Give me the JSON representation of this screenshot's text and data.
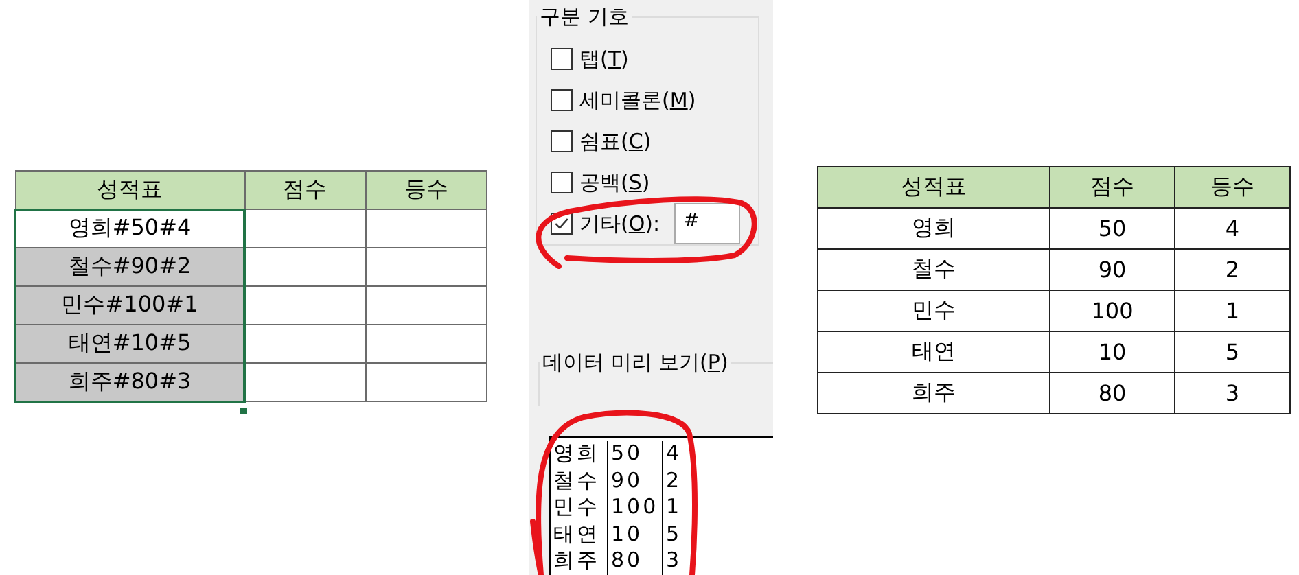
{
  "source_sheet": {
    "columns": [
      "성적표",
      "점수",
      "등수"
    ],
    "rows": [
      {
        "cells": [
          "영희#50#4",
          "",
          ""
        ],
        "active": true
      },
      {
        "cells": [
          "철수#90#2",
          "",
          ""
        ],
        "active": false
      },
      {
        "cells": [
          "민수#100#1",
          "",
          ""
        ],
        "active": false
      },
      {
        "cells": [
          "태연#10#5",
          "",
          ""
        ],
        "active": false
      },
      {
        "cells": [
          "희주#80#3",
          "",
          ""
        ],
        "active": false
      }
    ]
  },
  "delimiters": {
    "title": "구분 기호",
    "options": [
      {
        "label": "탭(",
        "key": "T",
        "tail": ")",
        "checked": false
      },
      {
        "label": "세미콜론(",
        "key": "M",
        "tail": ")",
        "checked": false
      },
      {
        "label": "쉼표(",
        "key": "C",
        "tail": ")",
        "checked": false
      },
      {
        "label": "공백(",
        "key": "S",
        "tail": ")",
        "checked": false
      },
      {
        "label": "기타(",
        "key": "O",
        "tail": "):",
        "checked": true,
        "value": "#"
      }
    ]
  },
  "preview": {
    "title": "데이터 미리 보기(",
    "key": "P",
    "tail": ")",
    "rows": [
      [
        "영희",
        "50",
        "4"
      ],
      [
        "철수",
        "90",
        "2"
      ],
      [
        "민수",
        "100",
        "1"
      ],
      [
        "태연",
        "10",
        "5"
      ],
      [
        "희주",
        "80",
        "3"
      ]
    ]
  },
  "result_sheet": {
    "columns": [
      "성적표",
      "점수",
      "등수"
    ],
    "rows": [
      [
        "영희",
        "50",
        "4"
      ],
      [
        "철수",
        "90",
        "2"
      ],
      [
        "민수",
        "100",
        "1"
      ],
      [
        "태연",
        "10",
        "5"
      ],
      [
        "희주",
        "80",
        "3"
      ]
    ]
  }
}
